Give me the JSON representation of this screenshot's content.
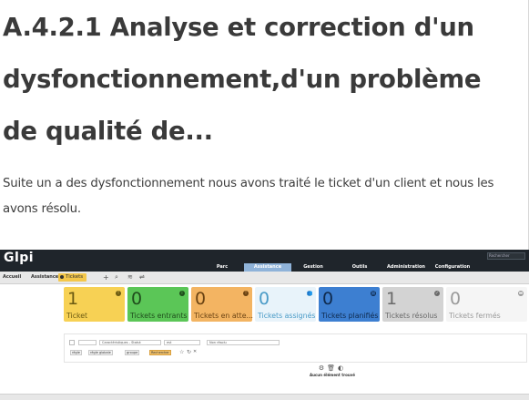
{
  "article": {
    "title": "A.4.2.1 Analyse et correction d'un dysfonctionnement,d'un problème de qualité de...",
    "paragraph": "Suite un a des dysfonctionnement nous avons traité le ticket d'un client et nous les avons résolu."
  },
  "glpi": {
    "logo": "Glpi",
    "search_placeholder": "Rechercher",
    "menu": [
      {
        "label": "Parc"
      },
      {
        "label": "Assistance"
      },
      {
        "label": "Gestion"
      },
      {
        "label": "Outils"
      },
      {
        "label": "Administration"
      },
      {
        "label": "Configuration"
      }
    ],
    "breadcrumb": {
      "home": "Accueil",
      "section": "Assistance",
      "current": "Tickets"
    },
    "tiles": [
      {
        "count": "1",
        "label": "Ticket",
        "bg": "#f7d154",
        "fg": "#6b5a12",
        "icon": "!"
      },
      {
        "count": "0",
        "label": "Tickets entrants",
        "bg": "#5bc657",
        "fg": "#1f4d1c",
        "icon": "i"
      },
      {
        "count": "0",
        "label": "Tickets en atte...",
        "bg": "#f3b462",
        "fg": "#6b4313",
        "icon": "!"
      },
      {
        "count": "0",
        "label": "Tickets assignés",
        "bg": "#e8f3fa",
        "fg": "#4a9bc7",
        "icon": "👥"
      },
      {
        "count": "0",
        "label": "Tickets planifiés",
        "bg": "#3d7fd1",
        "fg": "#0f2a4d",
        "icon": "▦"
      },
      {
        "count": "1",
        "label": "Tickets résolus",
        "bg": "#d3d3d3",
        "fg": "#6a6a6a",
        "icon": "✓"
      },
      {
        "count": "0",
        "label": "Tickets fermés",
        "bg": "#f5f5f5",
        "fg": "#9a9a9a",
        "icon": "▬"
      }
    ],
    "filters": {
      "criteria": "Caractéristiques - Statut",
      "operator": "est",
      "value": "Non résolu",
      "rule_button": "règle",
      "global_rule_button": "règle globale",
      "group_button": "groupe",
      "search_button": "Rechercher"
    },
    "empty_message": "Aucun élément trouvé"
  }
}
